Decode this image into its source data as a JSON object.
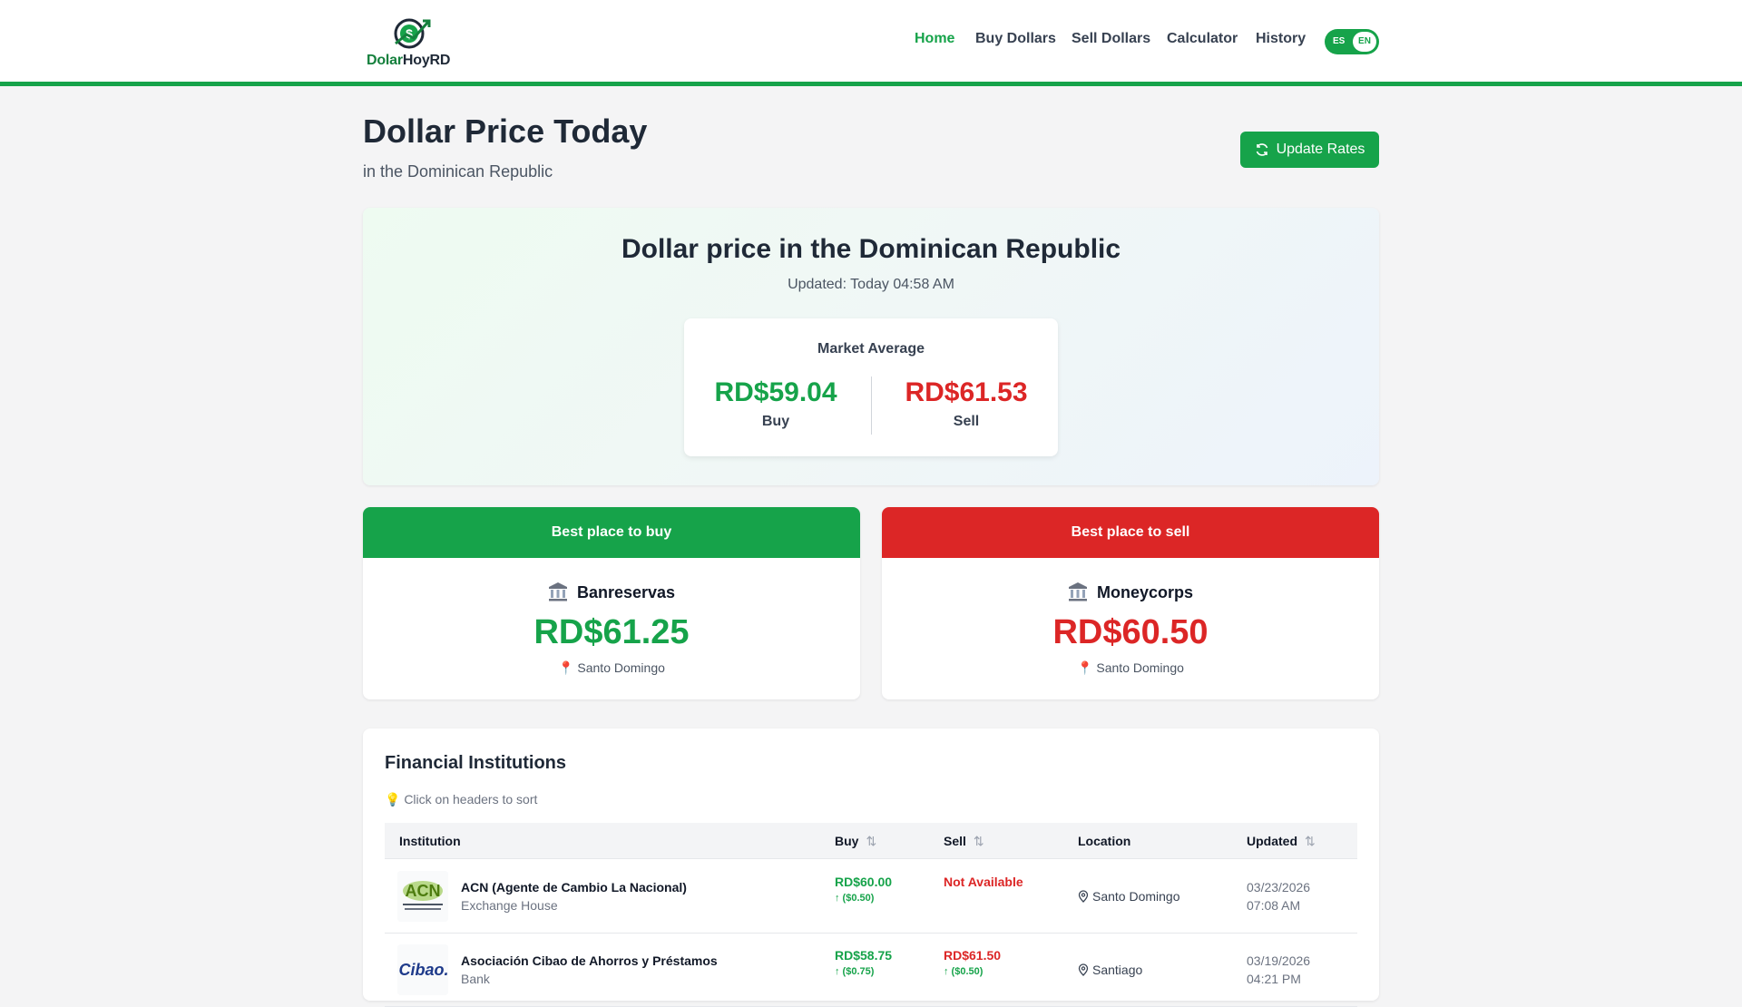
{
  "brand": {
    "name_part1": "Dolar",
    "name_part2": "HoyRD"
  },
  "nav": {
    "items": [
      "Home",
      "Buy Dollars",
      "Sell Dollars",
      "Calculator",
      "History"
    ],
    "lang_es": "ES",
    "lang_en": "EN"
  },
  "header": {
    "title": "Dollar Price Today",
    "subtitle": "in the Dominican Republic",
    "update_label": "Update Rates"
  },
  "hero": {
    "title": "Dollar price in the Dominican Republic",
    "updated": "Updated: Today 04:58 AM",
    "avg_label": "Market Average",
    "buy_value": "RD$59.04",
    "buy_label": "Buy",
    "sell_value": "RD$61.53",
    "sell_label": "Sell"
  },
  "best_buy": {
    "header": "Best place to buy",
    "name": "Banreservas",
    "price": "RD$61.25",
    "location": "📍 Santo Domingo"
  },
  "best_sell": {
    "header": "Best place to sell",
    "name": "Moneycorps",
    "price": "RD$60.50",
    "location": "📍 Santo Domingo"
  },
  "institutions": {
    "title": "Financial Institutions",
    "hint": "💡 Click on headers to sort",
    "columns": {
      "institution": "Institution",
      "buy": "Buy",
      "sell": "Sell",
      "location": "Location",
      "updated": "Updated"
    },
    "rows": [
      {
        "name": "ACN (Agente de Cambio La Nacional)",
        "type": "Exchange House",
        "buy": "RD$60.00",
        "buy_change": "↑ ($0.50)",
        "sell": "Not Available",
        "sell_change": "",
        "location": "Santo Domingo",
        "date": "03/23/2026",
        "time": "07:08 AM"
      },
      {
        "name": "Asociación Cibao de Ahorros y Préstamos",
        "type": "Bank",
        "buy": "RD$58.75",
        "buy_change": "↑ ($0.75)",
        "sell": "RD$61.50",
        "sell_change": "↑ ($0.50)",
        "location": "Santiago",
        "date": "03/19/2026",
        "time": "04:21 PM"
      }
    ]
  },
  "colors": {
    "green": "#16a34a",
    "red": "#dc2626"
  }
}
